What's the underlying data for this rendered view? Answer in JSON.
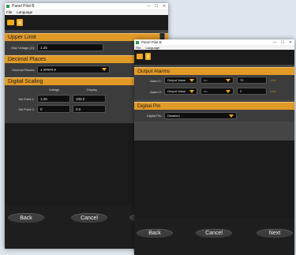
{
  "back_window": {
    "title": "Panel Pilot B",
    "menu": [
      "File",
      "Language"
    ],
    "upper_limit": {
      "header": "Upper Limit",
      "max_voltage_label": "Max Voltage (V):",
      "max_voltage_value": "1.25"
    },
    "decimal_places": {
      "header": "Decimal Places",
      "label": "Decimal Places:",
      "value": "1  #####.#"
    },
    "digital_scaling": {
      "header": "Digital Scaling",
      "col_voltage": "Voltage",
      "col_display": "Display",
      "rows": [
        {
          "label": "Set Point 1:",
          "voltage": "1.25",
          "display": "100.0"
        },
        {
          "label": "Set Point 2:",
          "voltage": "0",
          "display": "0.0"
        }
      ]
    },
    "buttons": {
      "back": "Back",
      "cancel": "Cancel"
    }
  },
  "front_window": {
    "title": "Panel Pilot B",
    "menu": [
      "File",
      "Language"
    ],
    "output_alarms": {
      "header": "Output Alarms",
      "rows": [
        {
          "label": "Alarm 1:",
          "source": "Output Value",
          "op": ">=",
          "value": "70",
          "unit": "Volts"
        },
        {
          "label": "Alarm 2:",
          "source": "Output Value",
          "op": "<=",
          "value": "2",
          "unit": "Volts"
        }
      ]
    },
    "digital_pin": {
      "header": "Digital Pin",
      "label": "Digital Pin:",
      "value": "Disabled"
    },
    "buttons": {
      "back": "Back",
      "cancel": "Cancel",
      "next": "Next"
    }
  },
  "icons": [
    "app-icon",
    "folder-icon",
    "save-icon",
    "minimize-icon",
    "maximize-icon",
    "close-icon",
    "dropdown-arrow-icon"
  ],
  "colors": {
    "accent": "#e29a27",
    "background": "#1b1b1b",
    "field": "#0e0e0e"
  }
}
